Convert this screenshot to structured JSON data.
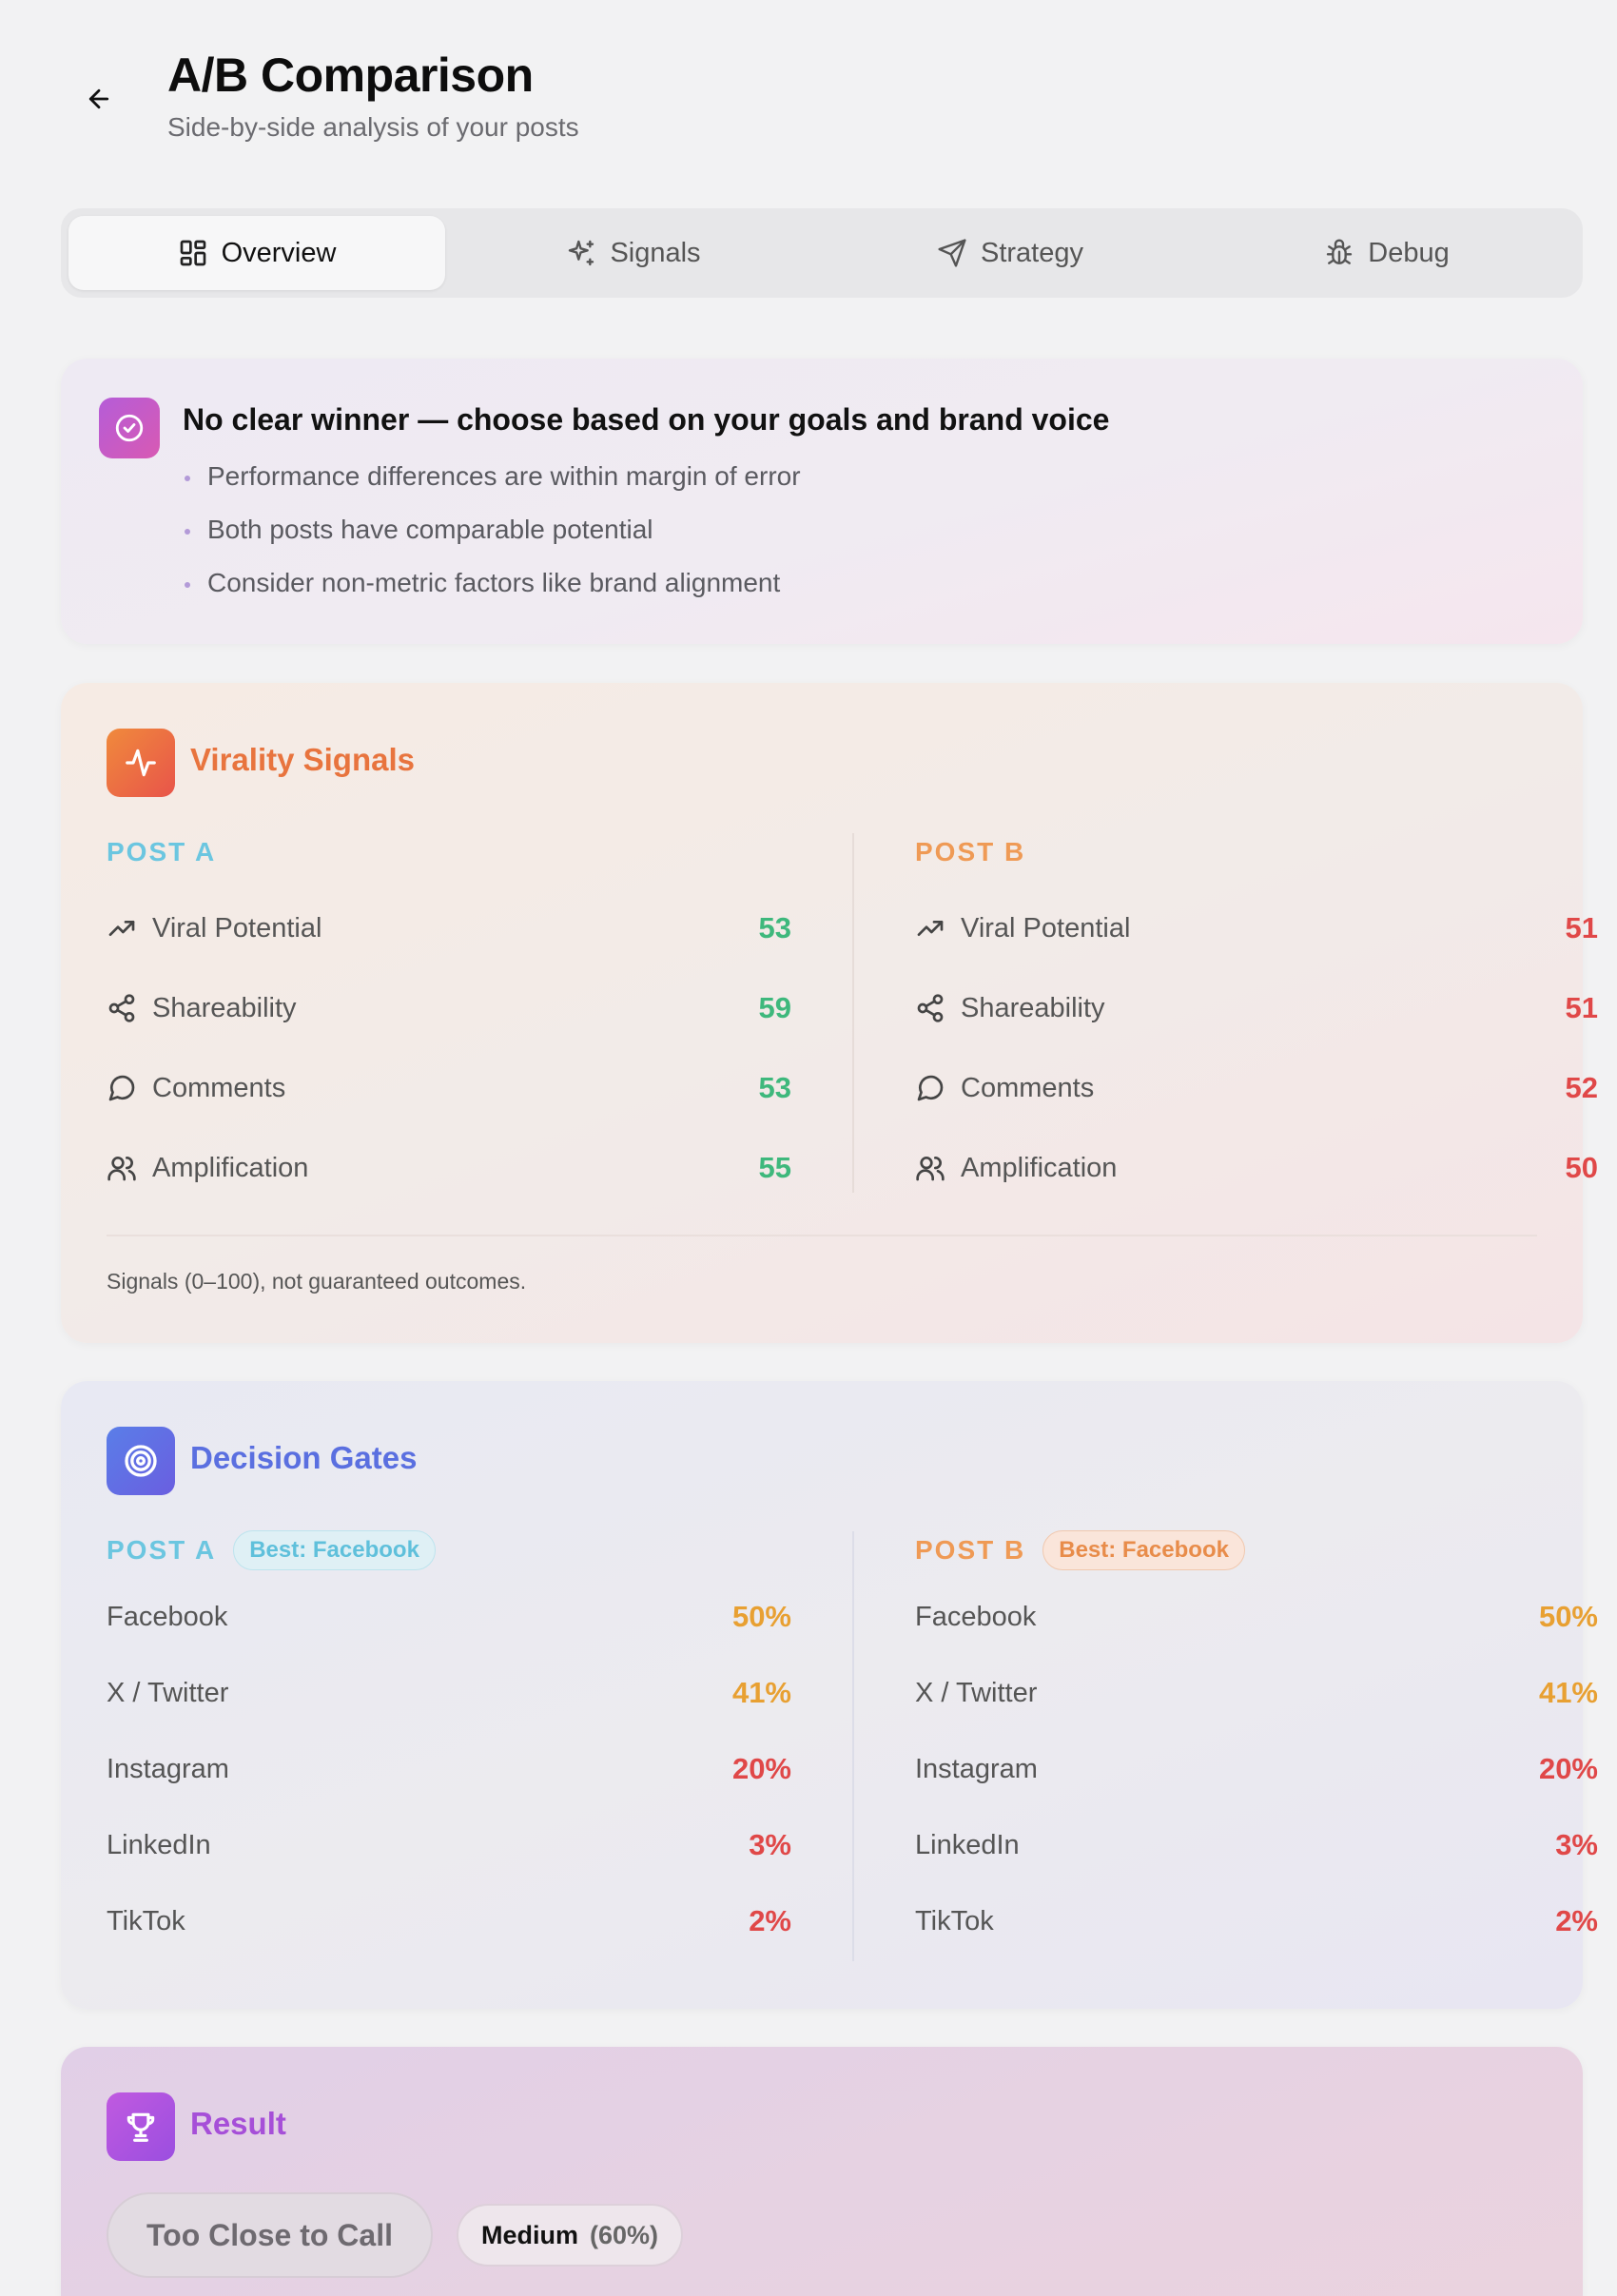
{
  "header": {
    "title": "A/B Comparison",
    "subtitle": "Side-by-side analysis of your posts"
  },
  "tabs": [
    {
      "label": "Overview",
      "icon": "grid-icon",
      "active": true
    },
    {
      "label": "Signals",
      "icon": "sparkle-icon",
      "active": false
    },
    {
      "label": "Strategy",
      "icon": "send-icon",
      "active": false
    },
    {
      "label": "Debug",
      "icon": "bug-icon",
      "active": false
    }
  ],
  "verdict": {
    "title": "No clear winner — choose based on your goals and brand voice",
    "icon": "check-circle-icon",
    "points": [
      "Performance differences are within margin of error",
      "Both posts have comparable potential",
      "Consider non-metric factors like brand alignment"
    ]
  },
  "virality": {
    "title": "Virality Signals",
    "icon": "activity-icon",
    "title_color": "#e8743e",
    "post_a": {
      "label": "POST A",
      "metrics": [
        {
          "label": "Viral Potential",
          "icon": "trending-up-icon",
          "value": "53"
        },
        {
          "label": "Shareability",
          "icon": "share-icon",
          "value": "59"
        },
        {
          "label": "Comments",
          "icon": "comment-icon",
          "value": "53"
        },
        {
          "label": "Amplification",
          "icon": "users-icon",
          "value": "55"
        }
      ]
    },
    "post_b": {
      "label": "POST B",
      "metrics": [
        {
          "label": "Viral Potential",
          "icon": "trending-up-icon",
          "value": "51"
        },
        {
          "label": "Shareability",
          "icon": "share-icon",
          "value": "51"
        },
        {
          "label": "Comments",
          "icon": "comment-icon",
          "value": "52"
        },
        {
          "label": "Amplification",
          "icon": "users-icon",
          "value": "50"
        }
      ]
    },
    "footnote": "Signals (0–100), not guaranteed outcomes."
  },
  "gates": {
    "title": "Decision Gates",
    "icon": "target-icon",
    "title_color": "#5a6fe0",
    "post_a": {
      "label": "POST A",
      "badge": "Best: Facebook",
      "platforms": [
        {
          "label": "Facebook",
          "value": "50%"
        },
        {
          "label": "X / Twitter",
          "value": "41%"
        },
        {
          "label": "Instagram",
          "value": "20%"
        },
        {
          "label": "LinkedIn",
          "value": "3%"
        },
        {
          "label": "TikTok",
          "value": "2%"
        }
      ]
    },
    "post_b": {
      "label": "POST B",
      "badge": "Best: Facebook",
      "platforms": [
        {
          "label": "Facebook",
          "value": "50%"
        },
        {
          "label": "X / Twitter",
          "value": "41%"
        },
        {
          "label": "Instagram",
          "value": "20%"
        },
        {
          "label": "LinkedIn",
          "value": "3%"
        },
        {
          "label": "TikTok",
          "value": "2%"
        }
      ]
    }
  },
  "result": {
    "title": "Result",
    "icon": "trophy-icon",
    "title_color": "#a64fd8",
    "verdict_label": "Too Close to Call",
    "confidence_level": "Medium",
    "confidence_pct": "(60%)"
  },
  "colors": {
    "green": "#3eb87c",
    "red": "#e04848",
    "orange": "#e8a032",
    "post_a": "#6bc6e0",
    "post_b": "#ef9a55"
  }
}
